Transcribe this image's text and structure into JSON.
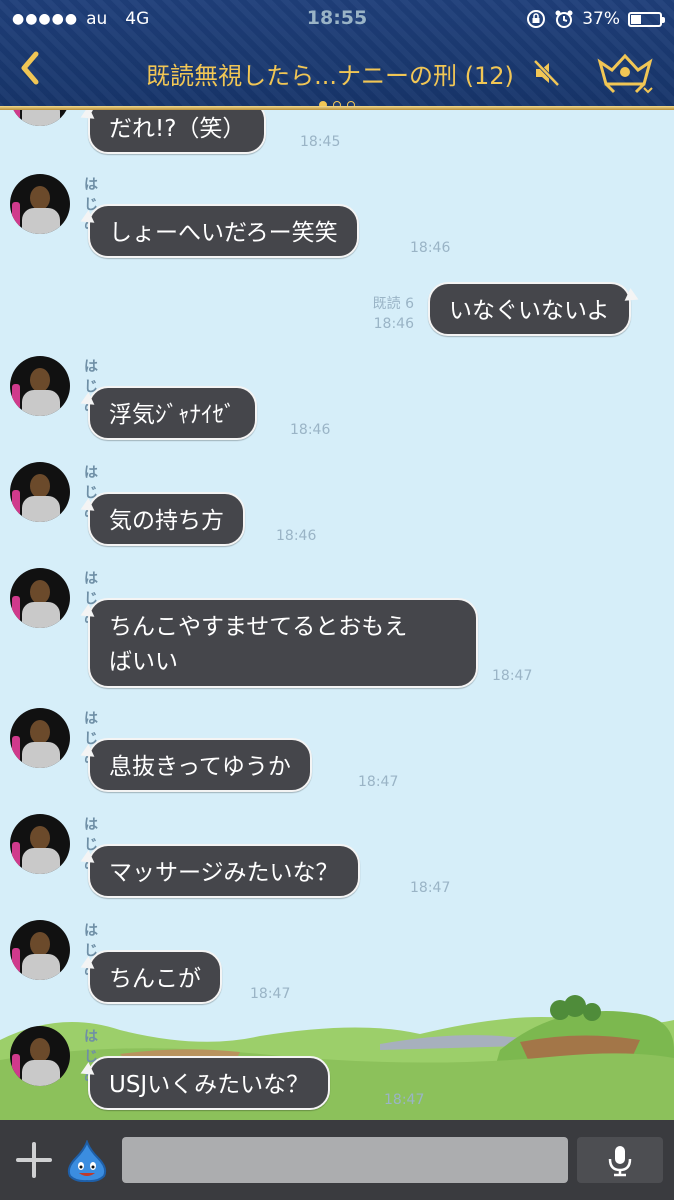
{
  "status_bar": {
    "signal": "●●●●●",
    "carrier": "au",
    "network": "4G",
    "time": "18:55",
    "battery": "37%",
    "battery_level": 0.37
  },
  "header": {
    "title": "既読無視したら...ナニーの刑 (12)",
    "back_icon": "chevron-left-icon",
    "mute_icon": "speaker-muted-icon",
    "menu_icon": "crest-icon",
    "page_count": 3,
    "page_active": 0
  },
  "messages": [
    {
      "type": "in",
      "name": "",
      "text": "だれ!?（笑）",
      "time": "18:45"
    },
    {
      "type": "in",
      "name": "はじめ",
      "text": "しょーへいだろー笑笑",
      "time": "18:46"
    },
    {
      "type": "out",
      "read": "既読 6",
      "text": "いなぐいないよ",
      "time": "18:46"
    },
    {
      "type": "in",
      "name": "はじめ",
      "text": "浮気ｼﾞｬﾅｲｾﾞ",
      "time": "18:46"
    },
    {
      "type": "in",
      "name": "はじめ",
      "text": "気の持ち方",
      "time": "18:46"
    },
    {
      "type": "in",
      "name": "はじめ",
      "line1": "ちんこやすませてるとおもえ",
      "line2": "ばいい",
      "time": "18:47"
    },
    {
      "type": "in",
      "name": "はじめ",
      "text": "息抜きってゆうか",
      "time": "18:47"
    },
    {
      "type": "in",
      "name": "はじめ",
      "text": "マッサージみたいな？",
      "time": "18:47"
    },
    {
      "type": "in",
      "name": "はじめ",
      "text": "ちんこが",
      "time": "18:47"
    },
    {
      "type": "in",
      "name": "はじめ",
      "text": "USJいくみたいな？",
      "time": "18:47"
    }
  ],
  "input_bar": {
    "plus_icon": "plus-icon",
    "sticker_icon": "slime-icon",
    "mic_icon": "microphone-icon"
  },
  "colors": {
    "header_bg": "#1f3f7a",
    "header_gold": "#f1c655",
    "chat_bg": "#d6eef9",
    "bubble_bg": "#45464b",
    "input_bar_bg": "#3a3b3f"
  }
}
